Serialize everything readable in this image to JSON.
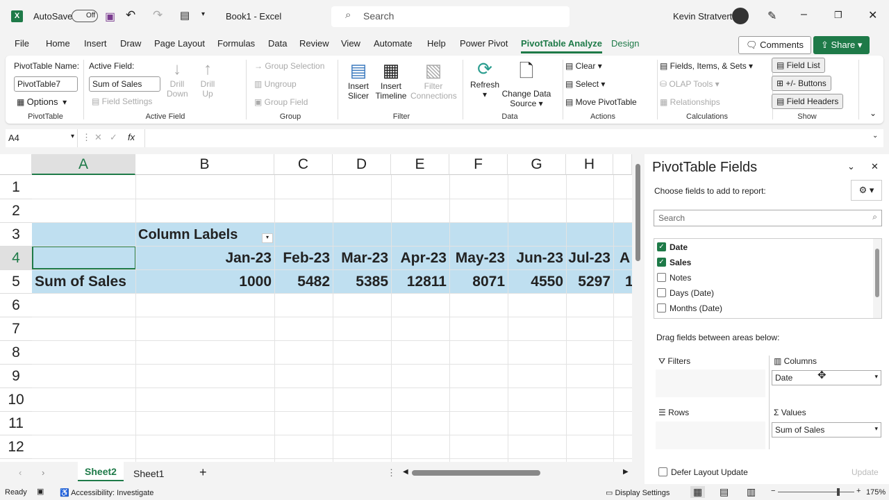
{
  "title_bar": {
    "autosave": "AutoSave",
    "autosave_state": "Off",
    "doc_title": "Book1  -  Excel",
    "search_placeholder": "Search",
    "user": "Kevin Stratvert"
  },
  "tabs": [
    "File",
    "Home",
    "Insert",
    "Draw",
    "Page Layout",
    "Formulas",
    "Data",
    "Review",
    "View",
    "Automate",
    "Help",
    "Power Pivot",
    "PivotTable Analyze",
    "Design"
  ],
  "active_tab": "PivotTable Analyze",
  "comments": "Comments",
  "share": "Share",
  "ribbon": {
    "pivottable": {
      "name_label": "PivotTable Name:",
      "name_value": "PivotTable7",
      "options": "Options",
      "group": "PivotTable"
    },
    "active_field": {
      "label": "Active Field:",
      "value": "Sum of Sales",
      "field_settings": "Field Settings",
      "drill_down": "Drill Down",
      "drill_up": "Drill Up",
      "group": "Active Field"
    },
    "group": {
      "group_selection": "Group Selection",
      "ungroup": "Ungroup",
      "group_field": "Group Field",
      "group": "Group"
    },
    "filter": {
      "insert_slicer": "Insert Slicer",
      "insert_timeline": "Insert Timeline",
      "filter_connections": "Filter Connections",
      "group": "Filter"
    },
    "data": {
      "refresh": "Refresh",
      "change_source": "Change Data Source",
      "group": "Data"
    },
    "actions": {
      "clear": "Clear",
      "select": "Select",
      "move": "Move PivotTable",
      "group": "Actions"
    },
    "calculations": {
      "fields": "Fields, Items, & Sets",
      "olap": "OLAP Tools",
      "relationships": "Relationships",
      "group": "Calculations"
    },
    "show": {
      "field_list": "Field List",
      "buttons": "+/- Buttons",
      "field_headers": "Field Headers",
      "group": "Show"
    }
  },
  "formula_bar": {
    "name_box": "A4",
    "fx": "fx",
    "value": ""
  },
  "columns": [
    "A",
    "B",
    "C",
    "D",
    "E",
    "F",
    "G",
    "H"
  ],
  "rows": [
    "1",
    "2",
    "3",
    "4",
    "5",
    "6",
    "7",
    "8",
    "9",
    "10",
    "11",
    "12"
  ],
  "pivot": {
    "column_labels": "Column Labels",
    "row_label": "Sum of Sales",
    "months": [
      "Jan-23",
      "Feb-23",
      "Mar-23",
      "Apr-23",
      "May-23",
      "Jun-23",
      "Jul-23"
    ],
    "values": [
      "1000",
      "5482",
      "5385",
      "12811",
      "8071",
      "4550",
      "5297"
    ],
    "partial_month": "A",
    "partial_value": "1"
  },
  "sheets": [
    "Sheet2",
    "Sheet1"
  ],
  "active_sheet": "Sheet2",
  "pane": {
    "title": "PivotTable Fields",
    "subtitle": "Choose fields to add to report:",
    "search_placeholder": "Search",
    "fields": [
      {
        "name": "Date",
        "checked": true
      },
      {
        "name": "Sales",
        "checked": true
      },
      {
        "name": "Notes",
        "checked": false
      },
      {
        "name": "Days (Date)",
        "checked": false
      },
      {
        "name": "Months (Date)",
        "checked": false
      }
    ],
    "drag_label": "Drag fields between areas below:",
    "filters": "Filters",
    "columns": "Columns",
    "columns_item": "Date",
    "rows": "Rows",
    "values": "Values",
    "values_item": "Sum of Sales",
    "defer": "Defer Layout Update",
    "update": "Update"
  },
  "status": {
    "ready": "Ready",
    "accessibility": "Accessibility: Investigate",
    "display": "Display Settings",
    "zoom": "175%",
    "zoom_value": 175
  },
  "accent": "#1e7a48",
  "pivot_band": "#bfdff0"
}
